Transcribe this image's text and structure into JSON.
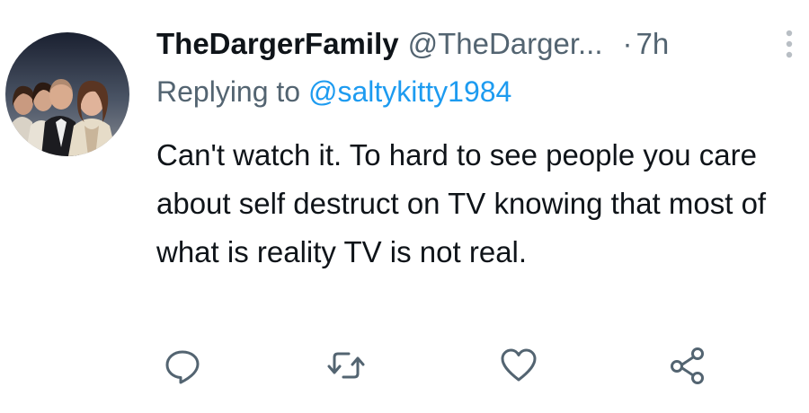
{
  "tweet": {
    "display_name": "TheDargerFamily",
    "handle": "@TheDarger...",
    "separator": "·",
    "time": "7h",
    "replying_prefix": "Replying to",
    "replying_to": "@saltykitty1984",
    "text": "Can't watch it. To hard to see people you care about self destruct on TV knowing that most of what is reality TV is not real."
  },
  "actions": {
    "icons": [
      "reply-icon",
      "retweet-icon",
      "like-icon",
      "share-icon"
    ]
  },
  "colors": {
    "text": "#0f1419",
    "secondary": "#536471",
    "link": "#1d9bf0"
  }
}
